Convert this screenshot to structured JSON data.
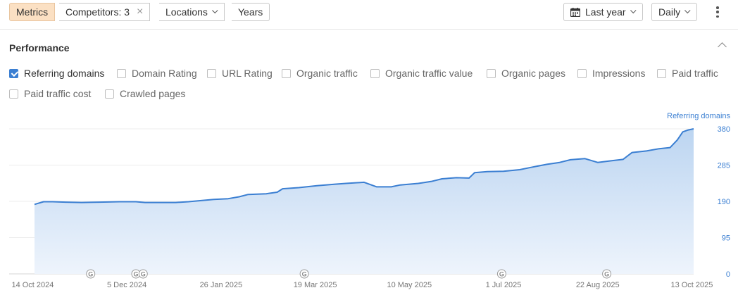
{
  "toolbar": {
    "tabs": [
      {
        "label": "Metrics"
      },
      {
        "label": "Competitors: 3"
      },
      {
        "label": "Locations"
      },
      {
        "label": "Years"
      }
    ],
    "date_range": "Last year",
    "granularity": "Daily"
  },
  "performance": {
    "title": "Performance",
    "metrics": [
      {
        "label": "Referring domains",
        "checked": true
      },
      {
        "label": "Domain Rating",
        "checked": false
      },
      {
        "label": "URL Rating",
        "checked": false
      },
      {
        "label": "Organic traffic",
        "checked": false
      },
      {
        "label": "Organic traffic value",
        "checked": false
      },
      {
        "label": "Organic pages",
        "checked": false
      },
      {
        "label": "Impressions",
        "checked": false
      },
      {
        "label": "Paid traffic",
        "checked": false
      },
      {
        "label": "Paid traffic cost",
        "checked": false
      },
      {
        "label": "Crawled pages",
        "checked": false
      }
    ]
  },
  "chart_data": {
    "type": "area",
    "series": [
      {
        "name": "Referring domains",
        "color": "#3b7fd2",
        "points": [
          [
            "2024-10-15",
            182
          ],
          [
            "2024-10-20",
            189
          ],
          [
            "2024-10-25",
            189
          ],
          [
            "2024-11-01",
            188
          ],
          [
            "2024-11-10",
            187
          ],
          [
            "2024-11-20",
            188
          ],
          [
            "2024-12-01",
            189
          ],
          [
            "2024-12-10",
            189
          ],
          [
            "2024-12-15",
            187
          ],
          [
            "2024-12-25",
            187
          ],
          [
            "2025-01-01",
            187
          ],
          [
            "2025-01-08",
            189
          ],
          [
            "2025-01-15",
            192
          ],
          [
            "2025-01-22",
            195
          ],
          [
            "2025-01-30",
            197
          ],
          [
            "2025-02-05",
            202
          ],
          [
            "2025-02-10",
            208
          ],
          [
            "2025-02-20",
            210
          ],
          [
            "2025-02-26",
            214
          ],
          [
            "2025-03-01",
            223
          ],
          [
            "2025-03-10",
            226
          ],
          [
            "2025-03-20",
            231
          ],
          [
            "2025-03-30",
            235
          ],
          [
            "2025-04-05",
            237
          ],
          [
            "2025-04-15",
            240
          ],
          [
            "2025-04-22",
            228
          ],
          [
            "2025-04-30",
            228
          ],
          [
            "2025-05-05",
            233
          ],
          [
            "2025-05-15",
            237
          ],
          [
            "2025-05-22",
            242
          ],
          [
            "2025-05-28",
            249
          ],
          [
            "2025-06-05",
            252
          ],
          [
            "2025-06-12",
            251
          ],
          [
            "2025-06-15",
            265
          ],
          [
            "2025-06-22",
            268
          ],
          [
            "2025-07-01",
            269
          ],
          [
            "2025-07-10",
            273
          ],
          [
            "2025-07-16",
            279
          ],
          [
            "2025-07-25",
            287
          ],
          [
            "2025-08-01",
            292
          ],
          [
            "2025-08-07",
            299
          ],
          [
            "2025-08-15",
            302
          ],
          [
            "2025-08-22",
            292
          ],
          [
            "2025-08-29",
            296
          ],
          [
            "2025-09-05",
            300
          ],
          [
            "2025-09-10",
            318
          ],
          [
            "2025-09-18",
            322
          ],
          [
            "2025-09-25",
            328
          ],
          [
            "2025-10-01",
            331
          ],
          [
            "2025-10-05",
            351
          ],
          [
            "2025-10-08",
            372
          ],
          [
            "2025-10-11",
            377
          ],
          [
            "2025-10-14",
            380
          ]
        ]
      }
    ],
    "x_ticks": [
      "14 Oct 2024",
      "5 Dec 2024",
      "26 Jan 2025",
      "19 Mar 2025",
      "10 May 2025",
      "1 Jul 2025",
      "22 Aug 2025",
      "13 Oct 2025"
    ],
    "x_tick_dates": [
      "2024-10-14",
      "2024-12-05",
      "2025-01-26",
      "2025-03-19",
      "2025-05-10",
      "2025-07-01",
      "2025-08-22",
      "2025-10-13"
    ],
    "xlim": [
      "2024-10-01",
      "2025-10-14"
    ],
    "y_ticks": [
      0,
      95,
      190,
      285,
      380
    ],
    "ylim": [
      0,
      380
    ],
    "ylabel": "Referring domains",
    "y_axis_position": "right",
    "grid": true,
    "annotation_markers": [
      {
        "date": "2024-11-15",
        "label": "G"
      },
      {
        "date": "2024-12-10",
        "label": "G"
      },
      {
        "date": "2024-12-14",
        "label": "G"
      },
      {
        "date": "2025-03-13",
        "label": "G"
      },
      {
        "date": "2025-06-30",
        "label": "G"
      },
      {
        "date": "2025-08-27",
        "label": "G"
      }
    ]
  }
}
